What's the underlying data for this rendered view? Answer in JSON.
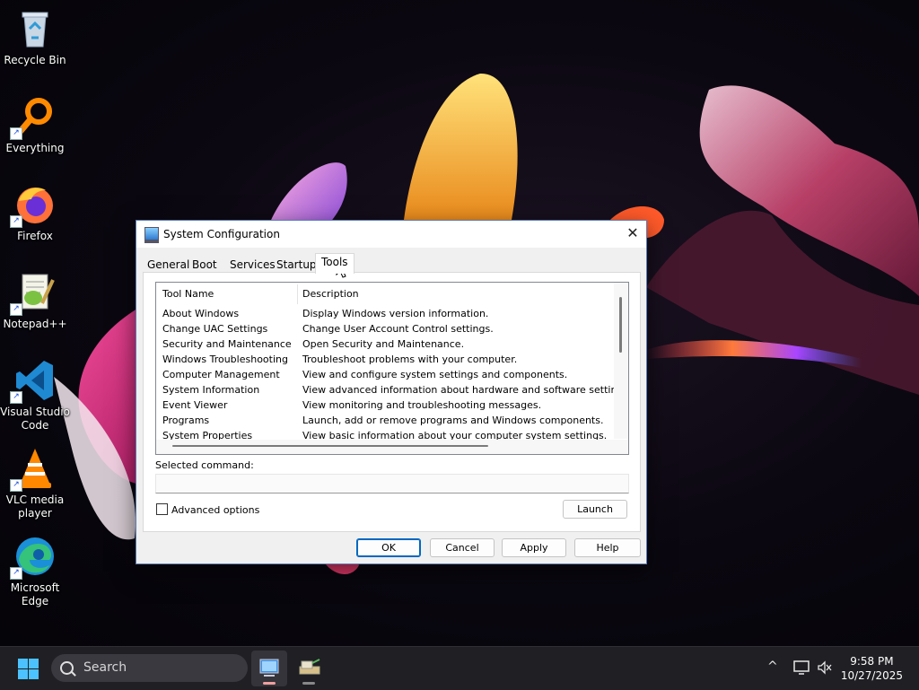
{
  "desktop": {
    "icons": [
      {
        "label": "Recycle Bin",
        "icon": "recycle-bin-icon",
        "shortcut": false
      },
      {
        "label": "Everything",
        "icon": "everything-icon",
        "shortcut": true
      },
      {
        "label": "Firefox",
        "icon": "firefox-icon",
        "shortcut": true
      },
      {
        "label": "Notepad++",
        "icon": "notepadpp-icon",
        "shortcut": true
      },
      {
        "label": "Visual Studio Code",
        "icon": "vscode-icon",
        "shortcut": true
      },
      {
        "label": "VLC media player",
        "icon": "vlc-icon",
        "shortcut": true
      },
      {
        "label": "Microsoft Edge",
        "icon": "edge-icon",
        "shortcut": true
      }
    ]
  },
  "dialog": {
    "title": "System Configuration",
    "close_symbol": "✕",
    "tabs": [
      {
        "label": "General",
        "active": false
      },
      {
        "label": "Boot",
        "active": false
      },
      {
        "label": "Services",
        "active": false
      },
      {
        "label": "Startup",
        "active": false
      },
      {
        "label": "Tools",
        "active": true
      }
    ],
    "table": {
      "columns": [
        "Tool Name",
        "Description"
      ],
      "rows": [
        [
          "About Windows",
          "Display Windows version information."
        ],
        [
          "Change UAC Settings",
          "Change User Account Control settings."
        ],
        [
          "Security and Maintenance",
          "Open Security and Maintenance."
        ],
        [
          "Windows Troubleshooting",
          "Troubleshoot problems with your computer."
        ],
        [
          "Computer Management",
          "View and configure system settings and components."
        ],
        [
          "System Information",
          "View advanced information about hardware and software settings."
        ],
        [
          "Event Viewer",
          "View monitoring and troubleshooting messages."
        ],
        [
          "Programs",
          "Launch, add or remove programs and Windows components."
        ],
        [
          "System Properties",
          "View basic information about your computer system settings."
        ]
      ]
    },
    "selected_command_label": "Selected command:",
    "selected_command_value": "",
    "advanced_options_label": "Advanced options",
    "advanced_options_checked": false,
    "launch_label": "Launch",
    "buttons": {
      "ok": "OK",
      "cancel": "Cancel",
      "apply": "Apply",
      "help": "Help"
    }
  },
  "taskbar": {
    "search_placeholder": "Search",
    "apps": [
      {
        "name": "system-configuration",
        "active": true
      },
      {
        "name": "setup-utility",
        "active": false
      }
    ],
    "tray": {
      "chevron": "^"
    },
    "clock": {
      "time": "9:58 PM",
      "date": "10/27/2025"
    }
  },
  "colors": {
    "accent": "#0067c0",
    "start": "#4cc2ff",
    "taskbar": "#1f1f24"
  }
}
